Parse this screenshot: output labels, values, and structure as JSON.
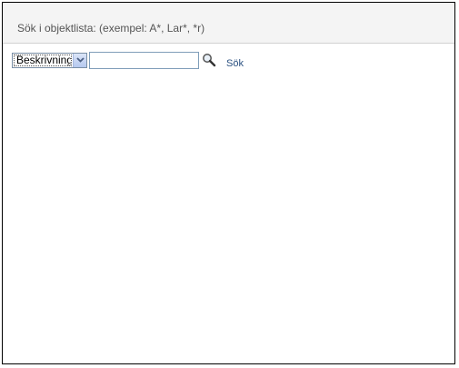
{
  "header": {
    "title": "Sök i objektlista: (exempel: A*, Lar*, *r)"
  },
  "search": {
    "field_select": {
      "selected": "Beskrivning"
    },
    "input": {
      "value": "",
      "placeholder": ""
    },
    "icon": "magnifier-icon",
    "link_label": "Sök"
  },
  "colors": {
    "header_background": "#f4f4f4",
    "link": "#2a5080",
    "frame_border": "#000000"
  }
}
